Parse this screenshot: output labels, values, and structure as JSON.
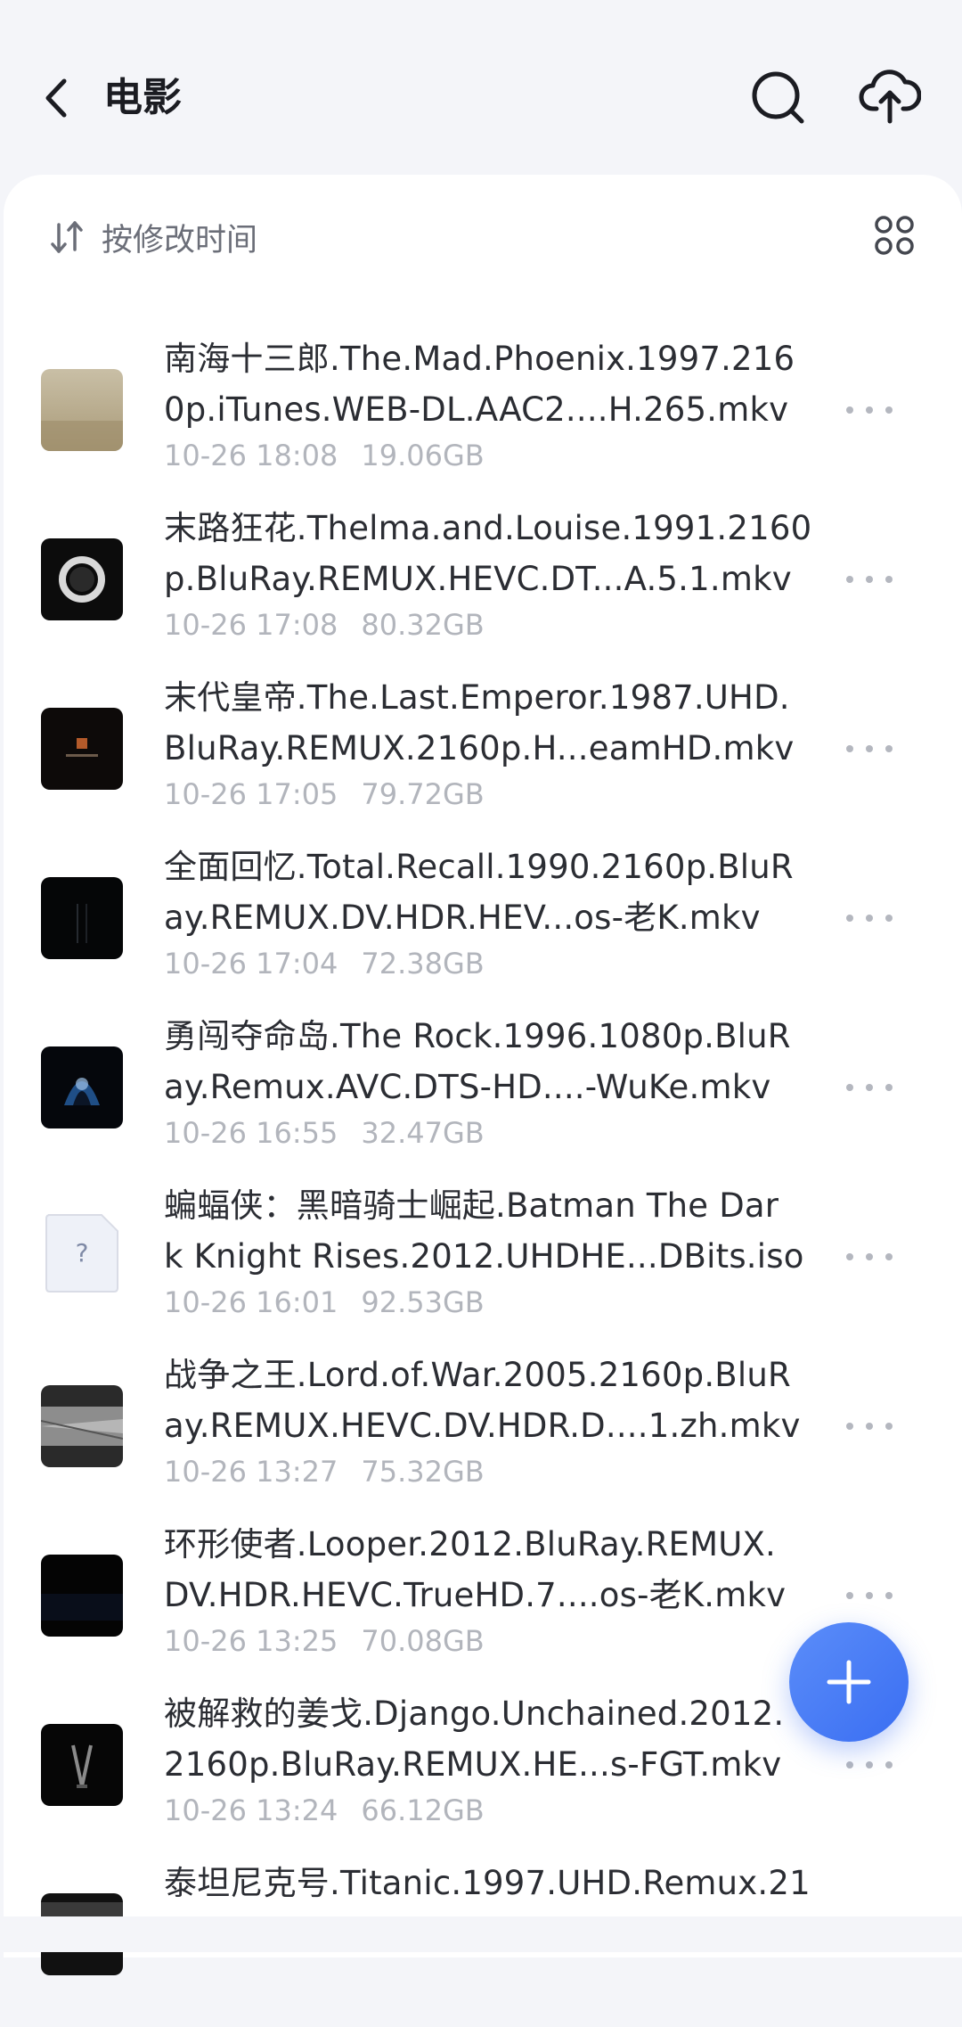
{
  "header": {
    "title": "电影",
    "back_icon": "chevron-left-icon",
    "search_icon": "search-icon",
    "upload_icon": "cloud-upload-icon"
  },
  "toolbar": {
    "sort_label": "按修改时间",
    "sort_icon": "sort-icon",
    "view_icon": "grid-view-icon"
  },
  "files": [
    {
      "name": "南海十三郎.The.Mad.Phoenix.1997.216\n0p.iTunes.WEB-DL.AAC2....H.265.mkv",
      "date": "10-26 18:08",
      "size": "19.06GB",
      "thumb": "tan"
    },
    {
      "name": "末路狂花.Thelma.and.Louise.1991.2160\np.BluRay.REMUX.HEVC.DT...A.5.1.mkv",
      "date": "10-26 17:08",
      "size": "80.32GB",
      "thumb": "ring"
    },
    {
      "name": "末代皇帝.The.Last.Emperor.1987.UHD.\nBluRay.REMUX.2160p.H...eamHD.mkv",
      "date": "10-26 17:05",
      "size": "79.72GB",
      "thumb": "emperor"
    },
    {
      "name": "全面回忆.Total.Recall.1990.2160p.BluR\nay.REMUX.DV.HDR.HEV...os-老K.mkv",
      "date": "10-26 17:04",
      "size": "72.38GB",
      "thumb": "dark"
    },
    {
      "name": "勇闯夺命岛.The Rock.1996.1080p.BluR\nay.Remux.AVC.DTS-HD....-WuKe.mkv",
      "date": "10-26 16:55",
      "size": "32.47GB",
      "thumb": "rock"
    },
    {
      "name": "蝙蝠侠：黑暗骑士崛起.Batman The Dar\nk Knight Rises.2012.UHDHE...DBits.iso",
      "date": "10-26 16:01",
      "size": "92.53GB",
      "thumb": "unknown"
    },
    {
      "name": "战争之王.Lord.of.War.2005.2160p.BluR\nay.REMUX.HEVC.DV.HDR.D....1.zh.mkv",
      "date": "10-26 13:27",
      "size": "75.32GB",
      "thumb": "war"
    },
    {
      "name": "环形使者.Looper.2012.BluRay.REMUX.\nDV.HDR.HEVC.TrueHD.7....os-老K.mkv",
      "date": "10-26 13:25",
      "size": "70.08GB",
      "thumb": "looper"
    },
    {
      "name": "被解救的姜戈.Django.Unchained.2012.\n2160p.BluRay.REMUX.HE...s-FGT.mkv",
      "date": "10-26 13:24",
      "size": "66.12GB",
      "thumb": "django"
    },
    {
      "name": "泰坦尼克号.Titanic.1997.UHD.Remux.21",
      "date": "",
      "size": "",
      "thumb": "titanic"
    }
  ],
  "fab": {
    "icon": "plus-icon"
  }
}
